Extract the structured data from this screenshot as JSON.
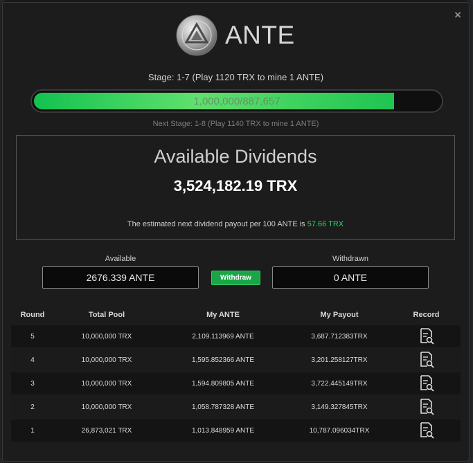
{
  "brand": {
    "name": "ANTE",
    "logo_icon": "ante-coin-icon"
  },
  "stage": {
    "current": "Stage: 1-7 (Play 1120 TRX to mine 1 ANTE)",
    "progress_label": "1,000,000/887,657",
    "progress_fraction": 0.887657,
    "next": "Next Stage: 1-8 (Play 1140 TRX to mine 1 ANTE)"
  },
  "dividends": {
    "title": "Available Dividends",
    "amount": "3,524,182.19 TRX",
    "note_prefix": "The estimated next dividend payout per 100 ANTE is",
    "note_value": "57.66 TRX"
  },
  "balances": {
    "available_label": "Available",
    "available_value": "2676.339 ANTE",
    "withdraw_button": "Withdraw",
    "withdrawn_label": "Withdrawn",
    "withdrawn_value": "0 ANTE"
  },
  "table": {
    "headers": [
      "Round",
      "Total Pool",
      "My ANTE",
      "My Payout",
      "Record"
    ],
    "rows": [
      {
        "round": "5",
        "pool": "10,000,000 TRX",
        "ante": "2,109.113969 ANTE",
        "payout": "3,687.712383TRX"
      },
      {
        "round": "4",
        "pool": "10,000,000 TRX",
        "ante": "1,595.852366 ANTE",
        "payout": "3,201.258127TRX"
      },
      {
        "round": "3",
        "pool": "10,000,000 TRX",
        "ante": "1,594.809805 ANTE",
        "payout": "3,722.445149TRX"
      },
      {
        "round": "2",
        "pool": "10,000,000 TRX",
        "ante": "1,058.787328 ANTE",
        "payout": "3,149.327845TRX"
      },
      {
        "round": "1",
        "pool": "26,873,021 TRX",
        "ante": "1,013.848959 ANTE",
        "payout": "10,787.096034TRX"
      }
    ]
  },
  "colors": {
    "accent_green": "#1aa547",
    "highlight_green": "#2fd36c",
    "background": "#1c1c1c"
  },
  "icons": {
    "close": "close-icon",
    "record": "record-search-icon"
  },
  "close_glyph": "×"
}
